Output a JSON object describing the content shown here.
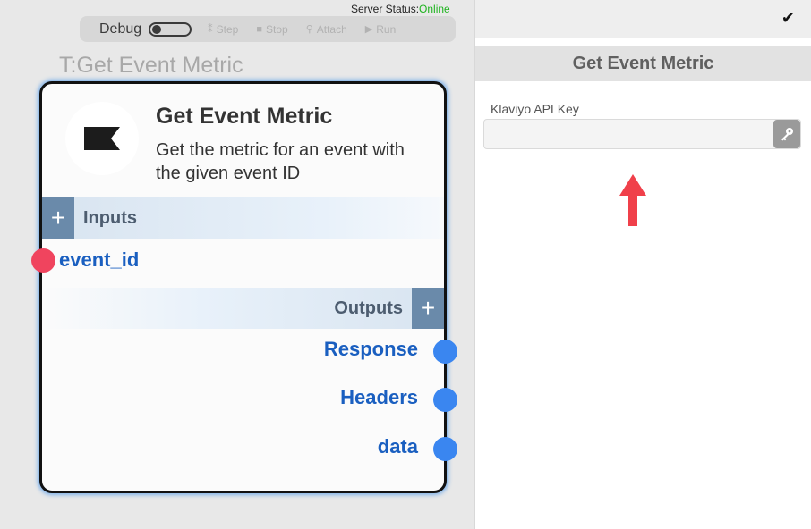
{
  "toolbar": {
    "server_status_label": "Server Status:",
    "server_status_value": "Online",
    "debug_label": "Debug",
    "buttons": [
      {
        "label": "Step",
        "icon": "step-icon",
        "glyph": "⁑"
      },
      {
        "label": "Stop",
        "icon": "stop-icon",
        "glyph": "■"
      },
      {
        "label": "Attach",
        "icon": "link-icon",
        "glyph": "⚲"
      },
      {
        "label": "Run",
        "icon": "play-icon",
        "glyph": "▶"
      }
    ]
  },
  "node": {
    "ghost_title": "T:Get Event Metric",
    "title": "Get Event Metric",
    "description": "Get the metric for an event with the given event ID",
    "logo_icon": "klaviyo-flag-icon",
    "inputs_label": "Inputs",
    "inputs": [
      {
        "name": "event_id",
        "port_color": "#f0445e"
      }
    ],
    "outputs_label": "Outputs",
    "outputs": [
      {
        "name": "Response",
        "port_color": "#3a86f0"
      },
      {
        "name": "Headers",
        "port_color": "#3a86f0"
      },
      {
        "name": "data",
        "port_color": "#3a86f0"
      }
    ]
  },
  "panel": {
    "title": "Get Event Metric",
    "confirm_icon": "checkmark-icon",
    "fields": [
      {
        "label": "Klaviyo API Key",
        "value": "",
        "button_icon": "key-icon"
      }
    ]
  },
  "colors": {
    "online": "#1eb31e",
    "accent_blue": "#1a5fc0",
    "annotation_arrow": "#f0404a"
  }
}
